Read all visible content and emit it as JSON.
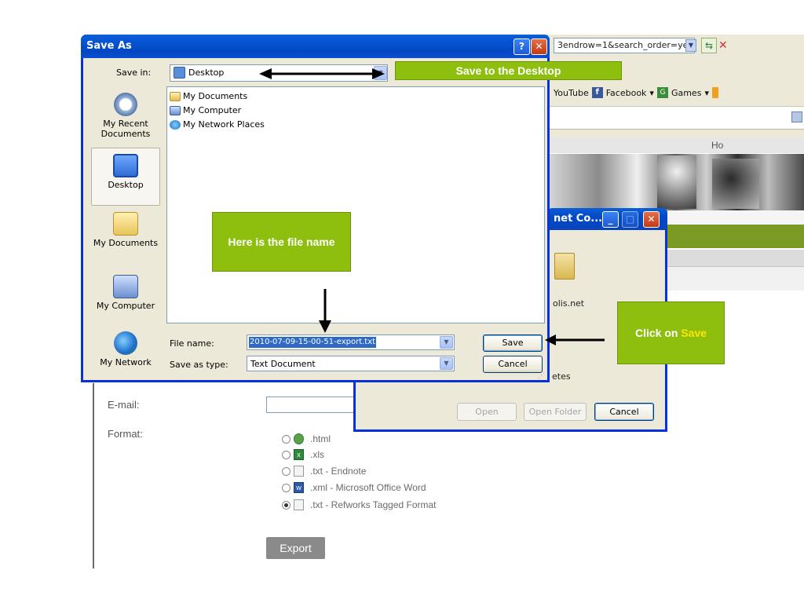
{
  "save_dialog": {
    "title": "Save As",
    "save_in_label": "Save in:",
    "save_in_value": "Desktop",
    "places": [
      "My Recent Documents",
      "Desktop",
      "My Documents",
      "My Computer",
      "My Network"
    ],
    "files": [
      "My Documents",
      "My Computer",
      "My Network Places"
    ],
    "file_name_label": "File name:",
    "file_name_value": "2010-07-09-15-00-51-export.txt",
    "save_as_type_label": "Save as type:",
    "save_as_type_value": "Text Document",
    "save_button": "Save",
    "cancel_button": "Cancel"
  },
  "annotations": {
    "save_to_desktop": "Save to the Desktop",
    "file_name_note": "Here is the file name",
    "click_on": "Click on ",
    "click_on_highlight": "Save"
  },
  "browser": {
    "url_text": "3endrow=1&search_order=ye",
    "links": [
      "YouTube",
      "Facebook",
      "Games"
    ],
    "site_header_text": "Ho"
  },
  "inet_dialog": {
    "title": "net Co...",
    "domain_text": "olis.net",
    "tes_text": "etes",
    "buttons": [
      "Open",
      "Open Folder",
      "Cancel"
    ]
  },
  "export_form": {
    "email_label": "E-mail:",
    "format_label": "Format:",
    "format_options": [
      ".html",
      ".xls",
      ".txt - Endnote",
      ".xml - Microsoft Office Word",
      ".txt - Refworks Tagged Format"
    ],
    "selected_format": ".txt - Refworks Tagged Format",
    "export_button": "Export"
  }
}
